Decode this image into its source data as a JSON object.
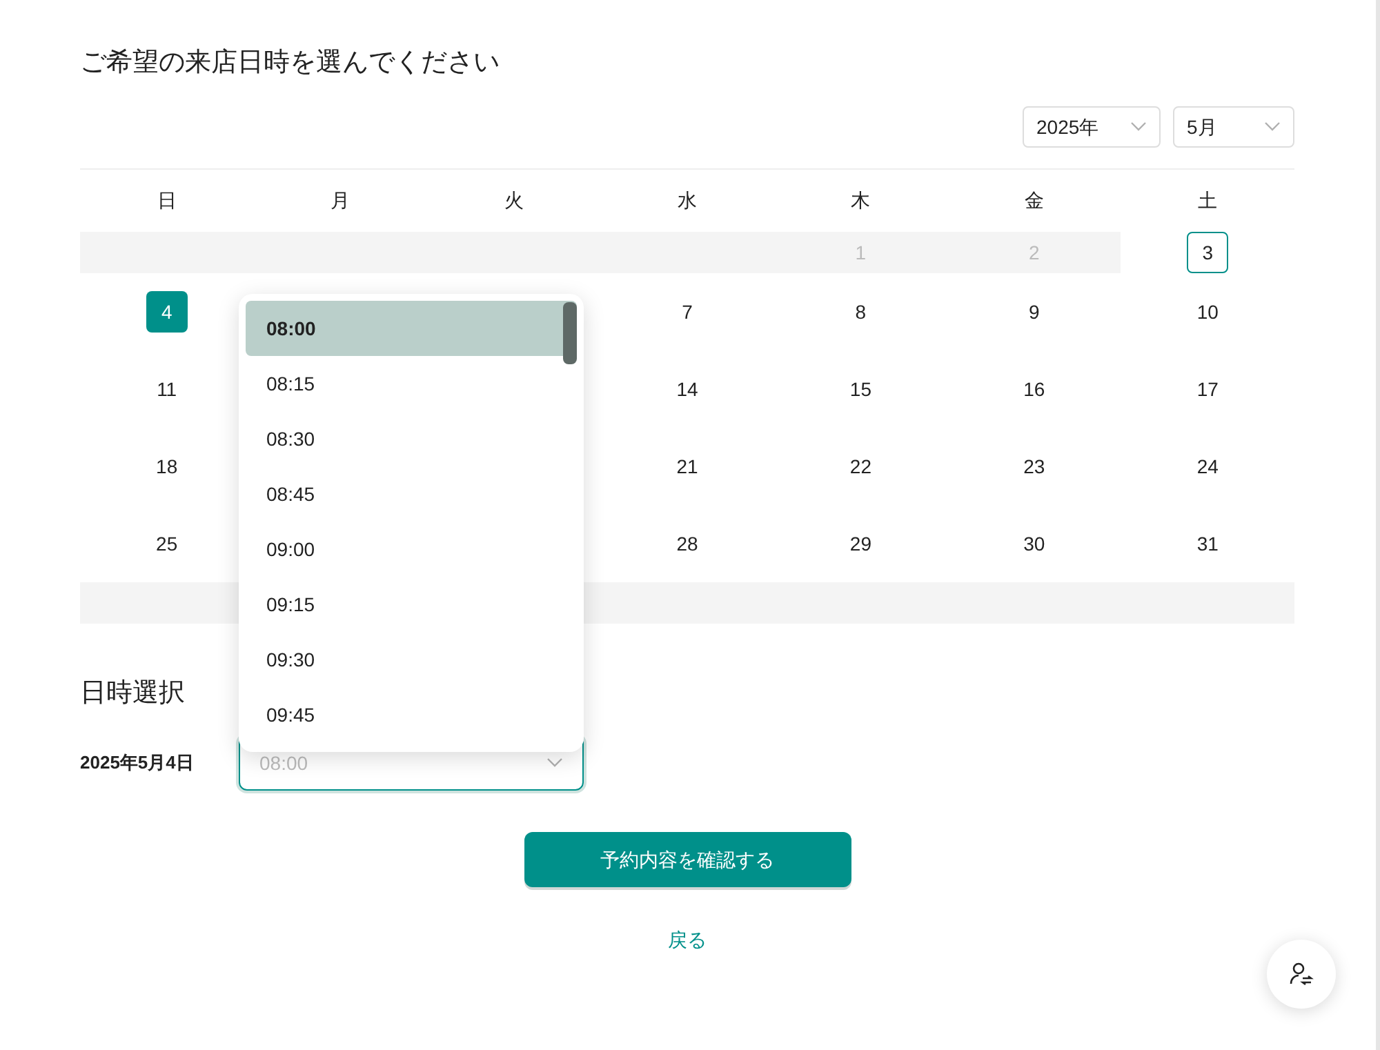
{
  "heading": "ご希望の来店日時を選んでください",
  "year_select": {
    "value": "2025年"
  },
  "month_select": {
    "value": "5月"
  },
  "weekdays": [
    "日",
    "月",
    "火",
    "水",
    "木",
    "金",
    "土"
  ],
  "weeks": [
    {
      "cells": [
        {
          "kind": "empty"
        },
        {
          "kind": "empty"
        },
        {
          "kind": "empty"
        },
        {
          "kind": "empty"
        },
        {
          "kind": "day",
          "day": "1",
          "disabled": true,
          "today": false,
          "selected": false
        },
        {
          "kind": "day",
          "day": "2",
          "disabled": true,
          "today": false,
          "selected": false
        },
        {
          "kind": "day",
          "day": "3",
          "disabled": false,
          "today": true,
          "selected": false
        }
      ]
    },
    {
      "cells": [
        {
          "kind": "day",
          "day": "4",
          "disabled": false,
          "today": false,
          "selected": true
        },
        {
          "kind": "covered"
        },
        {
          "kind": "covered"
        },
        {
          "kind": "day",
          "day": "7",
          "disabled": false,
          "today": false,
          "selected": false
        },
        {
          "kind": "day",
          "day": "8",
          "disabled": false,
          "today": false,
          "selected": false
        },
        {
          "kind": "day",
          "day": "9",
          "disabled": false,
          "today": false,
          "selected": false
        },
        {
          "kind": "day",
          "day": "10",
          "disabled": false,
          "today": false,
          "selected": false
        }
      ]
    },
    {
      "cells": [
        {
          "kind": "day",
          "day": "11",
          "disabled": false,
          "today": false,
          "selected": false
        },
        {
          "kind": "covered"
        },
        {
          "kind": "covered"
        },
        {
          "kind": "day",
          "day": "14",
          "disabled": false,
          "today": false,
          "selected": false
        },
        {
          "kind": "day",
          "day": "15",
          "disabled": false,
          "today": false,
          "selected": false
        },
        {
          "kind": "day",
          "day": "16",
          "disabled": false,
          "today": false,
          "selected": false
        },
        {
          "kind": "day",
          "day": "17",
          "disabled": false,
          "today": false,
          "selected": false
        }
      ]
    },
    {
      "cells": [
        {
          "kind": "day",
          "day": "18",
          "disabled": false,
          "today": false,
          "selected": false
        },
        {
          "kind": "covered"
        },
        {
          "kind": "covered"
        },
        {
          "kind": "day",
          "day": "21",
          "disabled": false,
          "today": false,
          "selected": false
        },
        {
          "kind": "day",
          "day": "22",
          "disabled": false,
          "today": false,
          "selected": false
        },
        {
          "kind": "day",
          "day": "23",
          "disabled": false,
          "today": false,
          "selected": false
        },
        {
          "kind": "day",
          "day": "24",
          "disabled": false,
          "today": false,
          "selected": false
        }
      ]
    },
    {
      "cells": [
        {
          "kind": "day",
          "day": "25",
          "disabled": false,
          "today": false,
          "selected": false
        },
        {
          "kind": "covered"
        },
        {
          "kind": "covered"
        },
        {
          "kind": "day",
          "day": "28",
          "disabled": false,
          "today": false,
          "selected": false
        },
        {
          "kind": "day",
          "day": "29",
          "disabled": false,
          "today": false,
          "selected": false
        },
        {
          "kind": "day",
          "day": "30",
          "disabled": false,
          "today": false,
          "selected": false
        },
        {
          "kind": "day",
          "day": "31",
          "disabled": false,
          "today": false,
          "selected": false
        }
      ]
    },
    {
      "cells": [
        {
          "kind": "empty"
        },
        {
          "kind": "empty"
        },
        {
          "kind": "empty"
        },
        {
          "kind": "empty"
        },
        {
          "kind": "empty"
        },
        {
          "kind": "empty"
        },
        {
          "kind": "empty"
        }
      ]
    }
  ],
  "section_title": "日時選択",
  "date_label": "2025年5月4日",
  "time_select": {
    "placeholder": "08:00",
    "expanded": true
  },
  "time_options": [
    {
      "label": "08:00",
      "selected": true
    },
    {
      "label": "08:15",
      "selected": false
    },
    {
      "label": "08:30",
      "selected": false
    },
    {
      "label": "08:45",
      "selected": false
    },
    {
      "label": "09:00",
      "selected": false
    },
    {
      "label": "09:15",
      "selected": false
    },
    {
      "label": "09:30",
      "selected": false
    },
    {
      "label": "09:45",
      "selected": false
    }
  ],
  "confirm_button": "予約内容を確認する",
  "back_link": "戻る"
}
